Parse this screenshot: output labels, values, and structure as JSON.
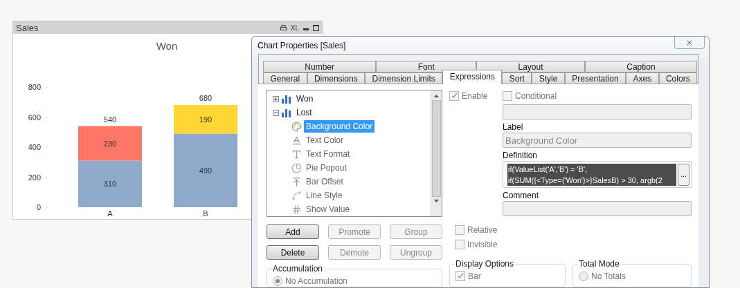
{
  "chart_window": {
    "title": "Sales",
    "xl_label": "XL",
    "chart_data": {
      "type": "bar",
      "title": "Won",
      "categories": [
        "A",
        "B"
      ],
      "series": [
        {
          "color": "#8ea9c9",
          "values": [
            310,
            490
          ]
        },
        {
          "color": "#fd7565",
          "values": [
            230,
            null
          ]
        },
        {
          "color": "#fdd835",
          "values": [
            null,
            190
          ]
        }
      ],
      "stacked": true,
      "ylim": [
        0,
        800
      ],
      "yticks": [
        0,
        200,
        400,
        600,
        800
      ],
      "data_labels": true,
      "annotations": [
        {
          "x": "A",
          "y": 540,
          "text": "540"
        },
        {
          "x": "B",
          "y": 680,
          "text": "680"
        }
      ]
    }
  },
  "dialog": {
    "title": "Chart Properties [Sales]"
  },
  "tab_rows": [
    [
      {
        "label": "Number",
        "selected": false
      },
      {
        "label": "Font",
        "selected": false
      },
      {
        "label": "Layout",
        "selected": false
      },
      {
        "label": "Caption",
        "selected": false
      }
    ],
    [
      {
        "label": "General",
        "selected": false
      },
      {
        "label": "Dimensions",
        "selected": false
      },
      {
        "label": "Dimension Limits",
        "selected": false
      },
      {
        "label": "Expressions",
        "selected": true
      },
      {
        "label": "Sort",
        "selected": false
      },
      {
        "label": "Style",
        "selected": false
      },
      {
        "label": "Presentation",
        "selected": false
      },
      {
        "label": "Axes",
        "selected": false
      },
      {
        "label": "Colors",
        "selected": false
      }
    ]
  ],
  "expressions_tree": [
    {
      "label": "Won",
      "kind": "expression",
      "expanded": false,
      "selected": false
    },
    {
      "label": "Lost",
      "kind": "expression",
      "expanded": true,
      "selected": false,
      "children": [
        {
          "label": "Background Color",
          "kind": "background-color",
          "selected": true
        },
        {
          "label": "Text Color",
          "kind": "text-color",
          "selected": false
        },
        {
          "label": "Text Format",
          "kind": "text-format",
          "selected": false
        },
        {
          "label": "Pie Popout",
          "kind": "pie-popout",
          "selected": false
        },
        {
          "label": "Bar Offset",
          "kind": "bar-offset",
          "selected": false
        },
        {
          "label": "Line Style",
          "kind": "line-style",
          "selected": false
        },
        {
          "label": "Show Value",
          "kind": "show-value",
          "selected": false
        }
      ]
    }
  ],
  "tree_buttons": [
    [
      {
        "label": "Add",
        "disabled": false
      },
      {
        "label": "Promote",
        "disabled": true
      },
      {
        "label": "Group",
        "disabled": true
      }
    ],
    [
      {
        "label": "Delete",
        "disabled": false
      },
      {
        "label": "Demote",
        "disabled": true
      },
      {
        "label": "Ungroup",
        "disabled": true
      }
    ]
  ],
  "enable": {
    "label": "Enable",
    "checked": true
  },
  "conditional": {
    "label": "Conditional",
    "checked": false
  },
  "label_field": {
    "label": "Label",
    "value": "Background Color"
  },
  "definition_field": {
    "label": "Definition",
    "lines": [
      "if(ValueList('A','B') = 'B',",
      "if(SUM({<Type={'Won'}>}SalesB) > 30, argb(2"
    ],
    "button": "..."
  },
  "comment_field": {
    "label": "Comment"
  },
  "flags": [
    {
      "label": "Relative",
      "checked": false
    },
    {
      "label": "Invisible",
      "checked": false
    }
  ],
  "accumulation": {
    "title": "Accumulation",
    "options": [
      {
        "label": "No Accumulation",
        "selected": true
      }
    ]
  },
  "display_options": {
    "title": "Display Options",
    "options": [
      {
        "label": "Bar",
        "checked": true
      }
    ]
  },
  "total_mode": {
    "title": "Total Mode",
    "options": [
      {
        "label": "No Totals",
        "selected": false
      }
    ]
  }
}
